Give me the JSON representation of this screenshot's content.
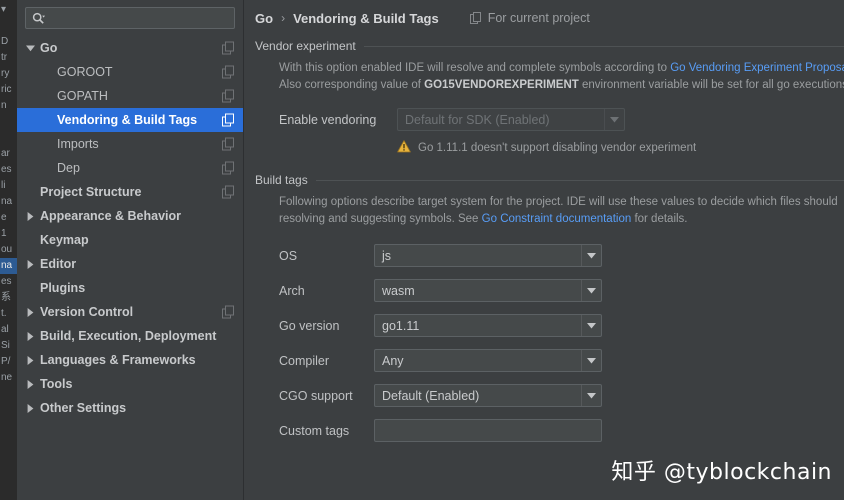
{
  "background_strip": {
    "lines": [
      "▾",
      "",
      "D",
      "tr",
      "ry",
      "ric",
      "n",
      "",
      "",
      "ar",
      "es",
      "li",
      "na",
      "e",
      "1",
      "ou",
      "na",
      "es",
      "系",
      "t.",
      "al",
      "Si",
      "P/",
      "ne"
    ],
    "selected_index": 16
  },
  "search": {
    "value": "",
    "placeholder": "",
    "icon": "search-icon",
    "dropdown_icon": "chevron-down-icon"
  },
  "sidebar": {
    "items": [
      {
        "label": "Go",
        "level": 1,
        "bold": true,
        "expanded": true,
        "arrow": "down",
        "badge": true,
        "selected": false
      },
      {
        "label": "GOROOT",
        "level": 2,
        "bold": false,
        "arrow": "none",
        "badge": true,
        "selected": false
      },
      {
        "label": "GOPATH",
        "level": 2,
        "bold": false,
        "arrow": "none",
        "badge": true,
        "selected": false
      },
      {
        "label": "Vendoring & Build Tags",
        "level": 2,
        "bold": false,
        "arrow": "none",
        "badge": true,
        "selected": true
      },
      {
        "label": "Imports",
        "level": 2,
        "bold": false,
        "arrow": "none",
        "badge": true,
        "selected": false
      },
      {
        "label": "Dep",
        "level": 2,
        "bold": false,
        "arrow": "none",
        "badge": true,
        "selected": false
      },
      {
        "label": "Project Structure",
        "level": 1,
        "bold": true,
        "arrow": "none",
        "badge": true,
        "selected": false
      },
      {
        "label": "Appearance & Behavior",
        "level": 1,
        "bold": true,
        "arrow": "right",
        "badge": false,
        "selected": false
      },
      {
        "label": "Keymap",
        "level": 1,
        "bold": true,
        "arrow": "none",
        "badge": false,
        "selected": false
      },
      {
        "label": "Editor",
        "level": 1,
        "bold": true,
        "arrow": "right",
        "badge": false,
        "selected": false
      },
      {
        "label": "Plugins",
        "level": 1,
        "bold": true,
        "arrow": "none",
        "badge": false,
        "selected": false
      },
      {
        "label": "Version Control",
        "level": 1,
        "bold": true,
        "arrow": "right",
        "badge": true,
        "selected": false
      },
      {
        "label": "Build, Execution, Deployment",
        "level": 1,
        "bold": true,
        "arrow": "right",
        "badge": false,
        "selected": false
      },
      {
        "label": "Languages & Frameworks",
        "level": 1,
        "bold": true,
        "arrow": "right",
        "badge": false,
        "selected": false
      },
      {
        "label": "Tools",
        "level": 1,
        "bold": true,
        "arrow": "right",
        "badge": false,
        "selected": false
      },
      {
        "label": "Other Settings",
        "level": 1,
        "bold": true,
        "arrow": "right",
        "badge": false,
        "selected": false
      }
    ]
  },
  "header": {
    "crumb_root": "Go",
    "crumb_separator": "›",
    "crumb_leaf": "Vendoring & Build Tags",
    "scope_label": "For current project",
    "scope_icon": "project-scope-icon"
  },
  "vendor_section": {
    "title": "Vendor experiment",
    "desc_line1_pre": "With this option enabled IDE will resolve and complete symbols according to ",
    "desc_line1_link": "Go Vendoring Experiment Proposa",
    "desc_line2_pre": "Also corresponding value of ",
    "desc_line2_bold": "GO15VENDOREXPERIMENT",
    "desc_line2_post": " environment variable will be set for all go executions f",
    "enable_label": "Enable vendoring",
    "enable_value": "Default for SDK (Enabled)",
    "enable_disabled": true,
    "warning_icon": "warning-triangle-icon",
    "warning_text": "Go 1.11.1 doesn't support disabling vendor experiment"
  },
  "build_tags_section": {
    "title": "Build tags",
    "desc_line1": "Following options describe target system for the project. IDE will use these values to decide which files should",
    "desc_line2_pre": "resolving and suggesting symbols. See ",
    "desc_line2_link": "Go Constraint documentation",
    "desc_line2_post": " for details.",
    "fields": [
      {
        "label": "OS",
        "value": "js",
        "type": "combo"
      },
      {
        "label": "Arch",
        "value": "wasm",
        "type": "combo"
      },
      {
        "label": "Go version",
        "value": "go1.11",
        "type": "combo"
      },
      {
        "label": "Compiler",
        "value": "Any",
        "type": "combo"
      },
      {
        "label": "CGO support",
        "value": "Default (Enabled)",
        "type": "combo"
      },
      {
        "label": "Custom tags",
        "value": "",
        "type": "text"
      }
    ]
  },
  "watermark": {
    "text": "知乎 @tyblockchain"
  },
  "colors": {
    "window_bg": "#3c3f41",
    "selection_blue": "#2a6ed9",
    "link_blue": "#589df6",
    "warning_yellow": "#e8b33c",
    "text_primary": "#bcbec0",
    "text_muted": "#9b9ea0"
  }
}
